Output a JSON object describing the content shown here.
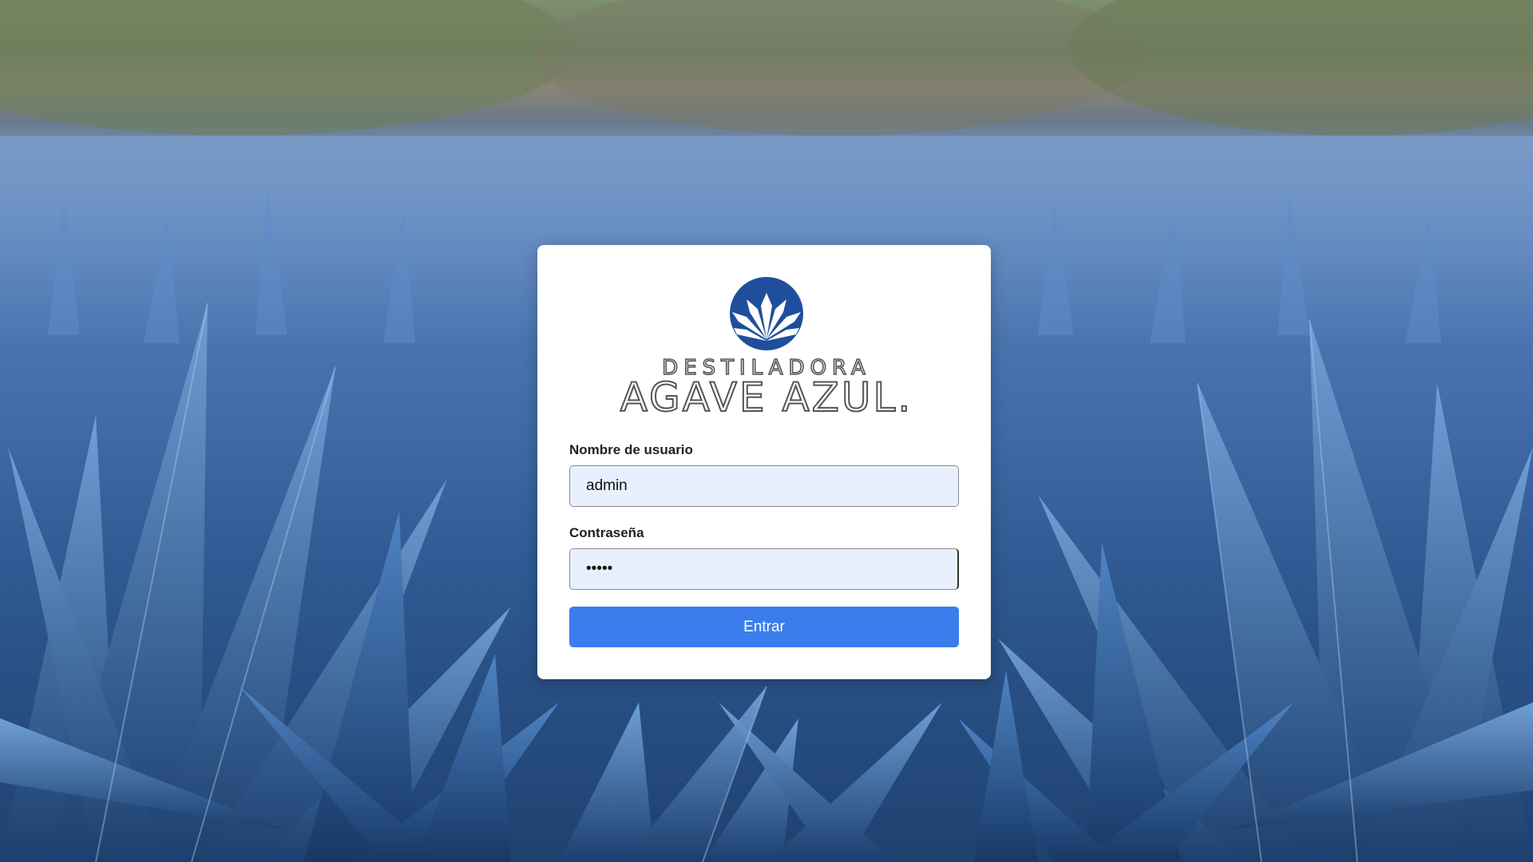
{
  "brand": {
    "line1": "DESTILADORA",
    "line2": "AGAVE AZUL.",
    "logo_color": "#1f4e9c"
  },
  "form": {
    "username_label": "Nombre de usuario",
    "username_value": "admin",
    "password_label": "Contraseña",
    "password_value": "•••••",
    "submit_label": "Entrar"
  },
  "colors": {
    "button": "#3b7ded",
    "input_bg": "#e8f0fe",
    "card_bg": "#ffffff"
  }
}
